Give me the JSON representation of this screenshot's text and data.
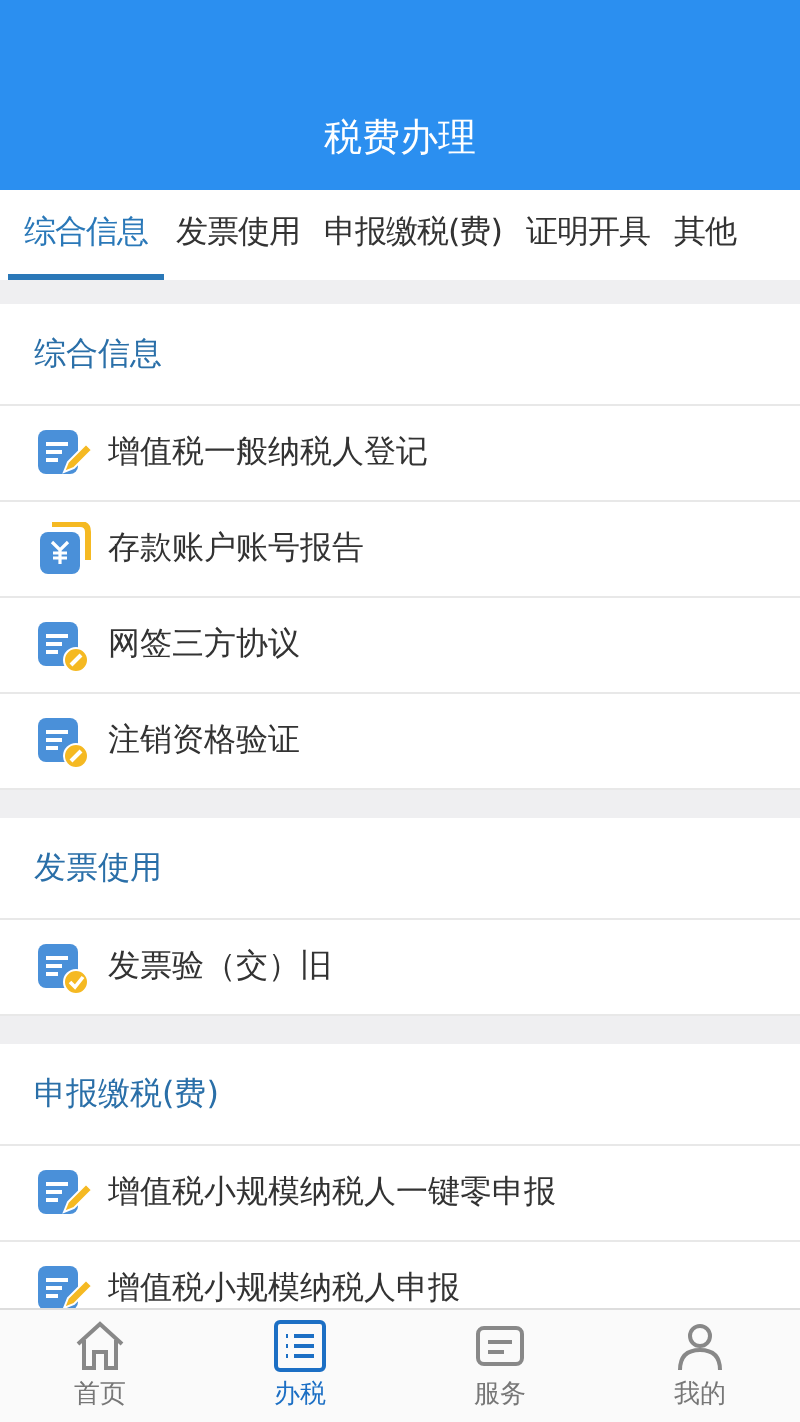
{
  "header": {
    "title": "税费办理"
  },
  "tabs": [
    {
      "label": "综合信息",
      "selected": true
    },
    {
      "label": "发票使用",
      "selected": false
    },
    {
      "label": "申报缴税(费)",
      "selected": false
    },
    {
      "label": "证明开具",
      "selected": false
    },
    {
      "label": "其他",
      "selected": false
    }
  ],
  "sections": [
    {
      "title": "综合信息",
      "items": [
        {
          "label": "增值税一般纳税人登记",
          "kind": "pencil"
        },
        {
          "label": "存款账户账号报告",
          "kind": "yen"
        },
        {
          "label": "网签三方协议",
          "kind": "link"
        },
        {
          "label": "注销资格验证",
          "kind": "link"
        }
      ]
    },
    {
      "title": "发票使用",
      "items": [
        {
          "label": "发票验（交）旧",
          "kind": "check"
        }
      ]
    },
    {
      "title": "申报缴税(费)",
      "items": [
        {
          "label": "增值税小规模纳税人一键零申报",
          "kind": "pencil"
        },
        {
          "label": "增值税小规模纳税人申报",
          "kind": "pencil"
        }
      ]
    }
  ],
  "bottom_nav": [
    {
      "label": "首页",
      "kind": "home",
      "selected": false
    },
    {
      "label": "办税",
      "kind": "list",
      "selected": true
    },
    {
      "label": "服务",
      "kind": "service",
      "selected": false
    },
    {
      "label": "我的",
      "kind": "user",
      "selected": false
    }
  ]
}
